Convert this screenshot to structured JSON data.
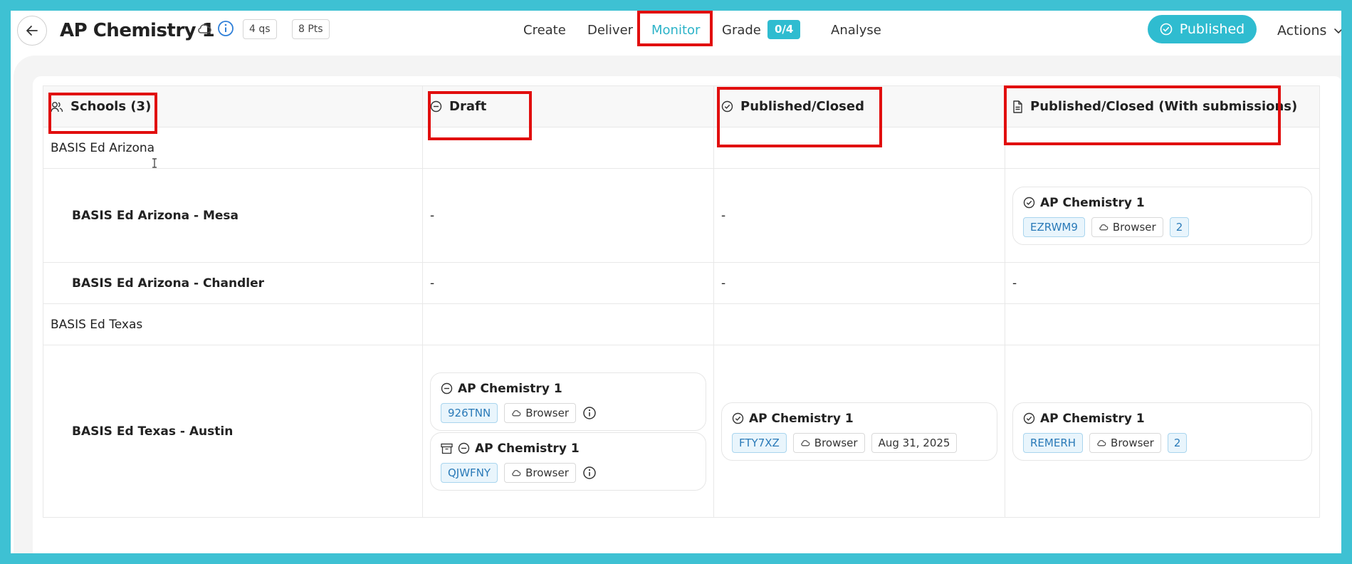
{
  "header": {
    "title": "AP Chemistry 1",
    "questions_chip": "4 qs",
    "points_chip": "8 Pts",
    "nav": {
      "create": "Create",
      "deliver": "Deliver",
      "monitor": "Monitor",
      "grade": "Grade",
      "grade_badge": "0/4",
      "analyse": "Analyse"
    },
    "status_button": "Published",
    "actions_label": "Actions"
  },
  "table": {
    "columns": {
      "schools": "Schools (3)",
      "draft": "Draft",
      "published_closed": "Published/Closed",
      "published_closed_with_submissions": "Published/Closed (With submissions)"
    },
    "dash": "-",
    "rows": {
      "arizona": "BASIS Ed Arizona",
      "arizona_mesa": "BASIS Ed Arizona - Mesa",
      "arizona_chandler": "BASIS Ed Arizona - Chandler",
      "texas": "BASIS Ed Texas",
      "texas_austin": "BASIS Ed Texas - Austin"
    },
    "cards": {
      "mesa_submissions": {
        "title": "AP Chemistry 1",
        "code": "EZRWM9",
        "mode": "Browser",
        "count": "2"
      },
      "austin_draft_1": {
        "title": "AP Chemistry 1",
        "code": "926TNN",
        "mode": "Browser"
      },
      "austin_draft_2": {
        "title": "AP Chemistry 1",
        "code": "QJWFNY",
        "mode": "Browser"
      },
      "austin_published": {
        "title": "AP Chemistry 1",
        "code": "FTY7XZ",
        "mode": "Browser",
        "date": "Aug 31, 2025"
      },
      "austin_submissions": {
        "title": "AP Chemistry 1",
        "code": "REMERH",
        "mode": "Browser",
        "count": "2"
      }
    }
  },
  "colors": {
    "accent": "#2fbcd0",
    "highlight": "#e10e0e",
    "code_tag_bg": "#e9f5fc",
    "code_tag_text": "#2a7ab8"
  }
}
